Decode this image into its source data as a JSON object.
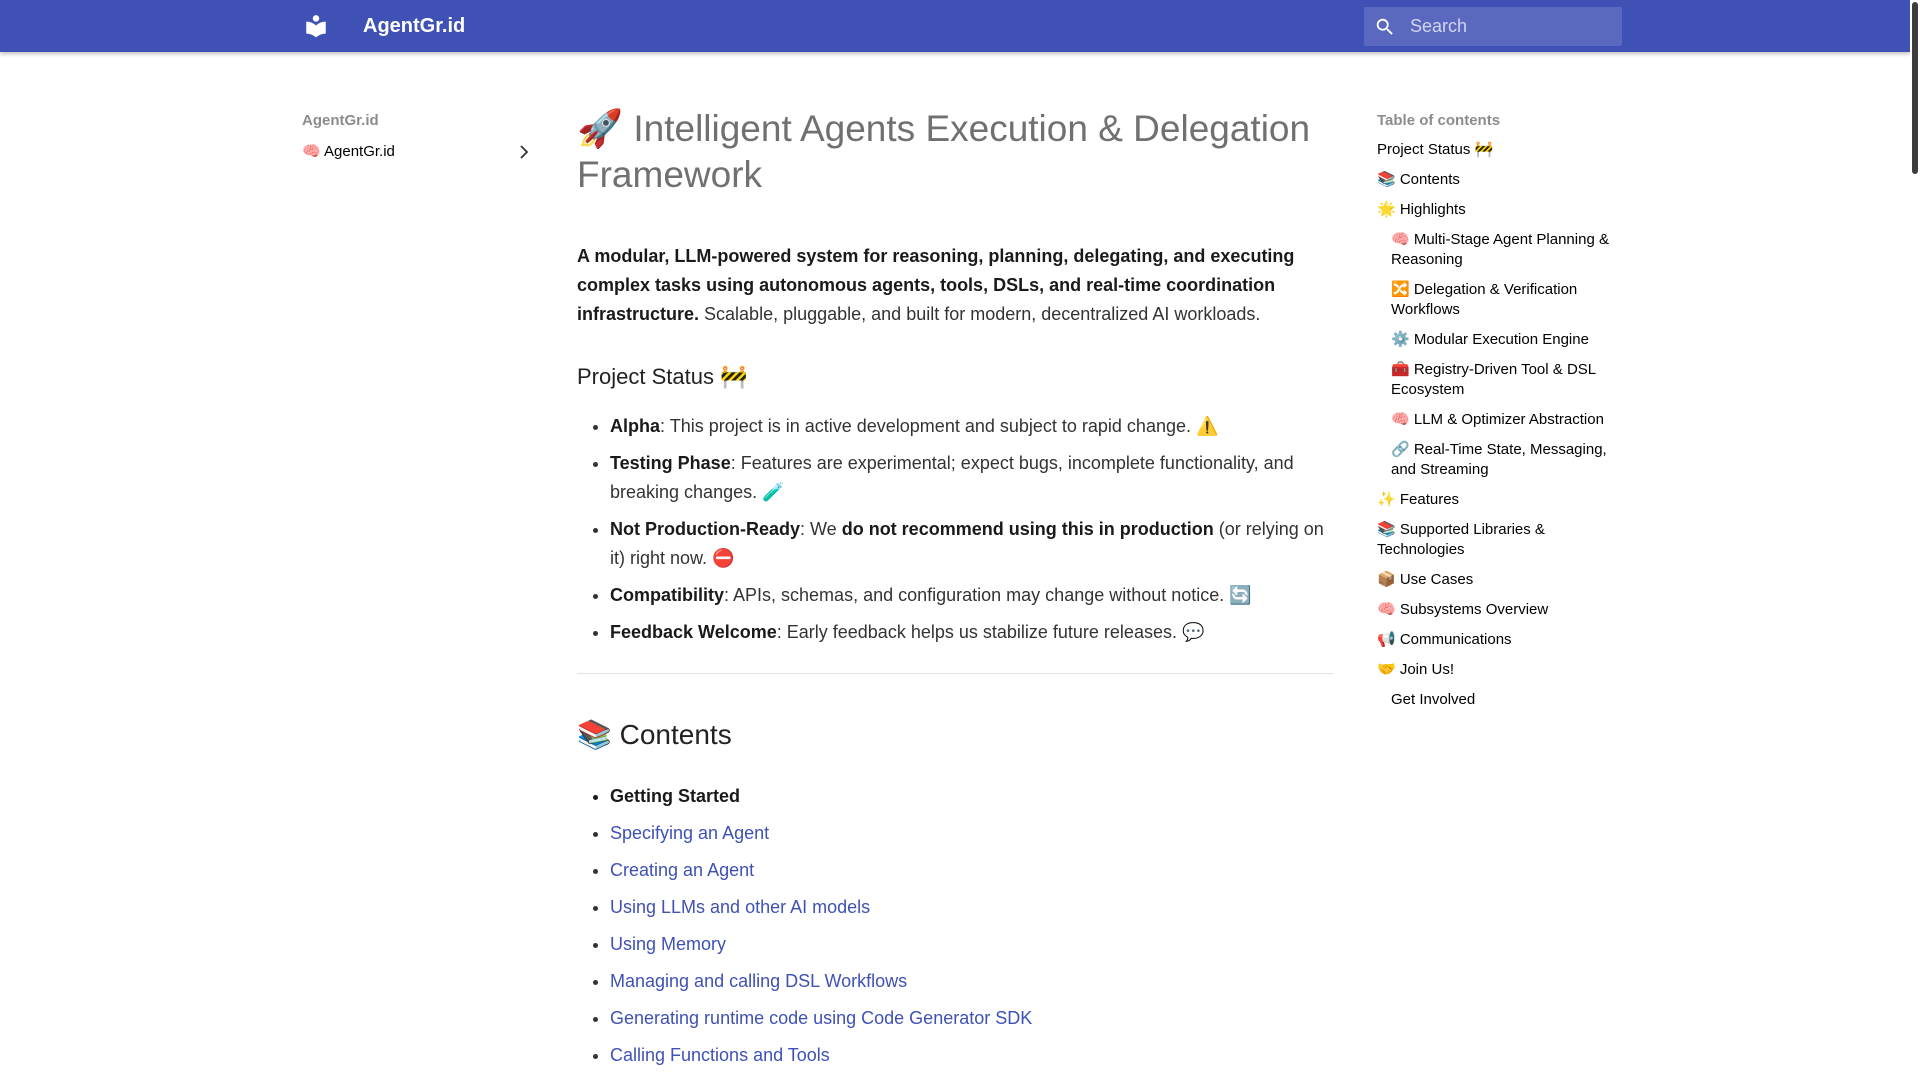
{
  "header": {
    "site_title": "AgentGr.id",
    "search_placeholder": "Search"
  },
  "nav": {
    "title": "AgentGr.id",
    "items": [
      {
        "label": "🧠 AgentGr.id"
      }
    ]
  },
  "main": {
    "title": "🚀 Intelligent Agents Execution & Delegation Framework",
    "intro_bold": "A modular, LLM-powered system for reasoning, planning, delegating, and executing complex tasks using autonomous agents, tools, DSLs, and real-time coordination infrastructure.",
    "intro_rest": " Scalable, pluggable, and built for modern, decentralized AI workloads.",
    "status_heading": "Project Status 🚧",
    "status_items": [
      {
        "term": "Alpha",
        "text": ": This project is in active development and subject to rapid change. ⚠️"
      },
      {
        "term": "Testing Phase",
        "text": ": Features are experimental; expect bugs, incomplete functionality, and breaking changes. 🧪"
      },
      {
        "term": "Not Production-Ready",
        "text_a": ": We ",
        "strong": "do not recommend using this in production",
        "text_b": " (or relying on it) right now. ⛔"
      },
      {
        "term": "Compatibility",
        "text": ": APIs, schemas, and configuration may change without notice. 🔄"
      },
      {
        "term": "Feedback Welcome",
        "text": ": Early feedback helps us stabilize future releases. 💬"
      }
    ],
    "contents_heading": "📚 Contents",
    "contents_items": [
      {
        "label": "Getting Started"
      },
      {
        "label": "Specifying an Agent"
      },
      {
        "label": "Creating an Agent"
      },
      {
        "label": "Using LLMs and other AI models"
      },
      {
        "label": "Using Memory"
      },
      {
        "label": "Managing and calling DSL Workflows"
      },
      {
        "label": "Generating runtime code using Code Generator SDK"
      },
      {
        "label": "Calling Functions and Tools"
      }
    ]
  },
  "toc": {
    "title": "Table of contents",
    "items": [
      {
        "label": "Project Status 🚧"
      },
      {
        "label": "📚 Contents"
      },
      {
        "label": "🌟 Highlights"
      },
      {
        "label": "🧠 Multi-Stage Agent Planning & Reasoning"
      },
      {
        "label": "🔀 Delegation & Verification Workflows"
      },
      {
        "label": "⚙️ Modular Execution Engine"
      },
      {
        "label": "🧰 Registry-Driven Tool & DSL Ecosystem"
      },
      {
        "label": "🧠 LLM & Optimizer Abstraction"
      },
      {
        "label": "🔗 Real-Time State, Messaging, and Streaming"
      },
      {
        "label": "✨ Features"
      },
      {
        "label": "📚 Supported Libraries & Technologies"
      },
      {
        "label": "📦 Use Cases"
      },
      {
        "label": "🧠 Subsystems Overview"
      },
      {
        "label": "📢 Communications"
      },
      {
        "label": "🤝 Join Us!"
      },
      {
        "label": "Get Involved"
      }
    ]
  },
  "colors": {
    "primary": "#3f51b5",
    "link": "#3f51b5"
  }
}
